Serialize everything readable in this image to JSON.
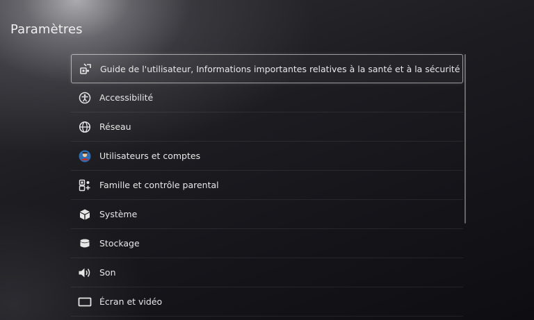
{
  "header": {
    "title": "Paramètres"
  },
  "settings": {
    "items": [
      {
        "label": "Guide de l'utilisateur, Informations importantes relatives à la santé et à la sécurité et autr",
        "icon": "user-guide-icon",
        "selected": true
      },
      {
        "label": "Accessibilité",
        "icon": "accessibility-icon"
      },
      {
        "label": "Réseau",
        "icon": "globe-icon"
      },
      {
        "label": "Utilisateurs et comptes",
        "icon": "user-avatar-icon"
      },
      {
        "label": "Famille et contrôle parental",
        "icon": "family-icon"
      },
      {
        "label": "Système",
        "icon": "system-cube-icon"
      },
      {
        "label": "Stockage",
        "icon": "storage-icon"
      },
      {
        "label": "Son",
        "icon": "speaker-icon"
      },
      {
        "label": "Écran et vidéo",
        "icon": "screen-icon"
      }
    ]
  }
}
